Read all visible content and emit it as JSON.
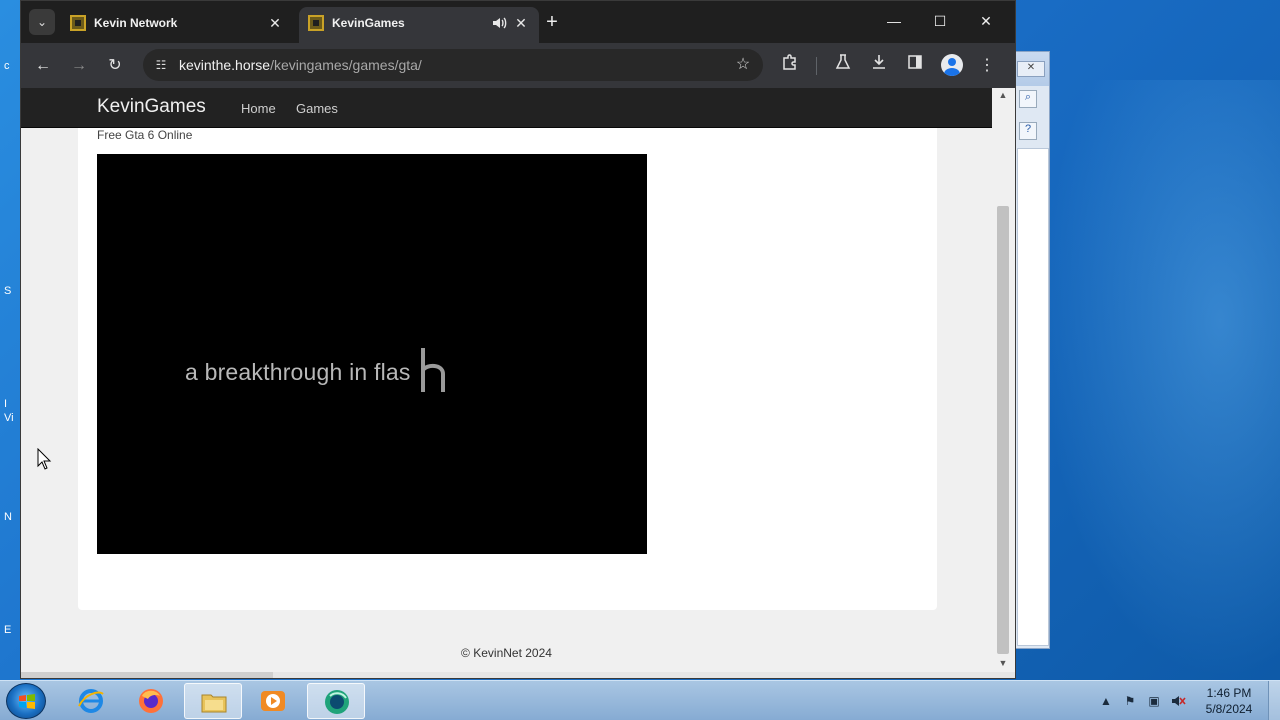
{
  "browser": {
    "tabs": [
      {
        "title": "Kevin Network",
        "active": false
      },
      {
        "title": "KevinGames",
        "active": true,
        "audio": true
      }
    ],
    "address": {
      "host": "kevinthe.horse",
      "path": "/kevingames/games/gta/"
    }
  },
  "page": {
    "brand": "KevinGames",
    "nav": [
      "Home",
      "Games"
    ],
    "subtitle": "Free Gta 6 Online",
    "game_overlay_text": "a breakthrough in flas",
    "footer": "© KevinNet 2024"
  },
  "taskbar": {
    "items": [
      "internet-explorer",
      "firefox",
      "file-explorer",
      "media-player",
      "chromium-browser"
    ],
    "clock": {
      "time": "1:46 PM",
      "date": "5/8/2024"
    }
  },
  "desktop": {
    "edge_text": [
      "c",
      "S",
      "I",
      "Vi",
      "N",
      "E"
    ]
  },
  "colors": {
    "browser_frame": "#1f1f1f",
    "toolbar": "#35363a",
    "site_navbar": "#222222",
    "desktop": "#1b6fc9"
  }
}
